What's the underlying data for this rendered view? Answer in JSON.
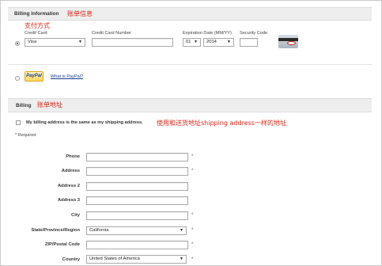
{
  "billing_info": {
    "title": "Billing Information",
    "annotation": "账单信息",
    "card_annotation": "支付方式",
    "credit_card_label": "Credit Card",
    "credit_card_value": "Visa",
    "card_number_label": "Credit Card Number",
    "card_number_value": "",
    "expiration_label": "Expiration Date (MM/YY)",
    "exp_month": "01",
    "exp_year": "2014",
    "security_code_label": "Security Code",
    "security_code_value": "",
    "paypal_label": "PayPal",
    "paypal_link": "What is PayPal?"
  },
  "billing": {
    "title": "Billing",
    "annotation": "账单地址",
    "same_address_label": "My billing address is the same as my shipping address.",
    "same_address_annotation": "使用和送货地址shipping address一样的地址",
    "required_note": "* Required",
    "fields": [
      {
        "label": "Phone",
        "value": "",
        "required": "*",
        "type": "input"
      },
      {
        "label": "Address",
        "value": "",
        "required": "*",
        "type": "input"
      },
      {
        "label": "Address 2",
        "value": "",
        "required": "",
        "type": "input"
      },
      {
        "label": "Address 3",
        "value": "",
        "required": "",
        "type": "input"
      },
      {
        "label": "City",
        "value": "",
        "required": "*",
        "type": "input"
      },
      {
        "label": "State/Province/Region",
        "value": "California",
        "required": "*",
        "type": "select"
      },
      {
        "label": "ZIP/Postal Code",
        "value": "",
        "required": "*",
        "type": "input"
      },
      {
        "label": "Country",
        "value": "United States of America",
        "required": "*",
        "type": "select"
      }
    ]
  },
  "colors": {
    "annotation_red": "#d9281b",
    "section_bar": "#eeeeee",
    "link_blue": "#1b3f8f"
  },
  "icons": [
    "dropdown-arrow-icon",
    "paypal-logo-icon",
    "cvv-card-icon"
  ]
}
